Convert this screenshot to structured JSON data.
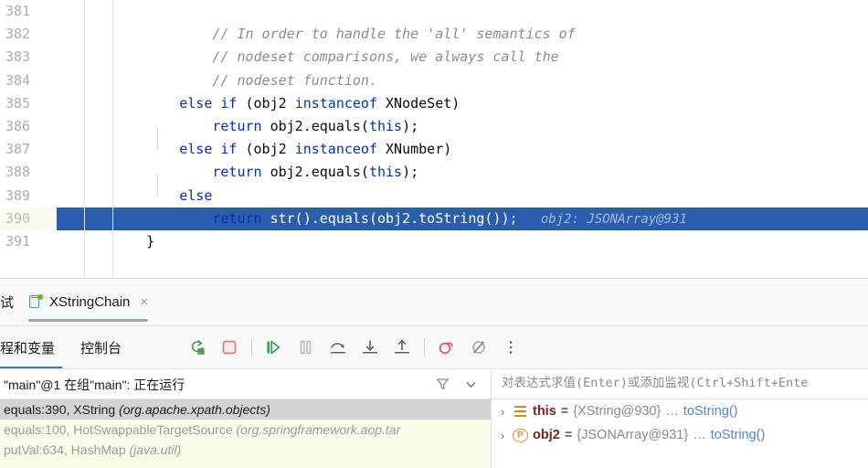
{
  "editor": {
    "lines": [
      {
        "num": "381",
        "segments": []
      },
      {
        "num": "382",
        "segments": [
          {
            "t": "comment",
            "text": "            // In order to handle the 'all' semantics of"
          }
        ]
      },
      {
        "num": "383",
        "segments": [
          {
            "t": "comment",
            "text": "            // nodeset comparisons, we always call the"
          }
        ]
      },
      {
        "num": "384",
        "segments": [
          {
            "t": "comment",
            "text": "            // nodeset function."
          }
        ]
      },
      {
        "num": "385",
        "segments": [
          {
            "t": "plain",
            "text": "        "
          },
          {
            "t": "kw",
            "text": "else"
          },
          {
            "t": "plain",
            "text": " "
          },
          {
            "t": "kw",
            "text": "if"
          },
          {
            "t": "plain",
            "text": " (obj2 "
          },
          {
            "t": "kw",
            "text": "instanceof"
          },
          {
            "t": "plain",
            "text": " XNodeSet)"
          }
        ]
      },
      {
        "num": "386",
        "segments": [
          {
            "t": "plain",
            "text": "            "
          },
          {
            "t": "kw",
            "text": "return"
          },
          {
            "t": "plain",
            "text": " obj2.equals("
          },
          {
            "t": "kw",
            "text": "this"
          },
          {
            "t": "plain",
            "text": ");"
          }
        ]
      },
      {
        "num": "387",
        "segments": [
          {
            "t": "plain",
            "text": "        "
          },
          {
            "t": "kw",
            "text": "else"
          },
          {
            "t": "plain",
            "text": " "
          },
          {
            "t": "kw",
            "text": "if"
          },
          {
            "t": "plain",
            "text": " (obj2 "
          },
          {
            "t": "kw",
            "text": "instanceof"
          },
          {
            "t": "plain",
            "text": " XNumber)"
          }
        ]
      },
      {
        "num": "388",
        "segments": [
          {
            "t": "plain",
            "text": "            "
          },
          {
            "t": "kw",
            "text": "return"
          },
          {
            "t": "plain",
            "text": " obj2.equals("
          },
          {
            "t": "kw",
            "text": "this"
          },
          {
            "t": "plain",
            "text": ");"
          }
        ]
      },
      {
        "num": "389",
        "segments": [
          {
            "t": "plain",
            "text": "        "
          },
          {
            "t": "kw",
            "text": "else"
          }
        ]
      },
      {
        "num": "390",
        "selected": true,
        "current": true,
        "segments": [
          {
            "t": "plain",
            "text": "            "
          },
          {
            "t": "kw",
            "text": "return"
          },
          {
            "t": "plain",
            "text": " str().equals(obj2.toString());"
          },
          {
            "t": "hint",
            "text": "   obj2: JSONArray@931"
          }
        ]
      },
      {
        "num": "391",
        "segments": [
          {
            "t": "plain",
            "text": "    }"
          }
        ]
      }
    ],
    "colors": {
      "keyword": "#0033b3",
      "comment": "#8c8c8c",
      "selection": "#2a5db0",
      "current_line": "#fcfaef"
    }
  },
  "tabbar": {
    "debug_tab_label": "试",
    "file_tab_label": "XStringChain",
    "close_label": "×"
  },
  "debugbar": {
    "tabs": [
      {
        "label": "程和变量",
        "active": true
      },
      {
        "label": "控制台",
        "active": false
      }
    ],
    "actions": [
      {
        "name": "rerun-icon"
      },
      {
        "name": "stop-icon"
      },
      {
        "name": "resume-icon"
      },
      {
        "name": "pause-icon"
      },
      {
        "name": "step-over-icon"
      },
      {
        "name": "step-into-icon"
      },
      {
        "name": "step-out-icon"
      },
      {
        "name": "view-breakpoints-icon"
      },
      {
        "name": "mute-breakpoints-icon"
      },
      {
        "name": "more-options-icon"
      }
    ]
  },
  "threads": {
    "selected": "\"main\"@1 在组\"main\": 正在运行",
    "frames": [
      {
        "method": "equals:390, XString ",
        "pkg": "(org.apache.xpath.objects)",
        "selected": true
      },
      {
        "method": "equals:100, HotSwappableTargetSource ",
        "pkg": "(org.springframework.aop.tar",
        "selected": false
      },
      {
        "method": "putVal:634, HashMap ",
        "pkg": "(java.util)",
        "selected": false
      }
    ]
  },
  "watch": {
    "placeholder": "对表达式求值(Enter)或添加监视(Ctrl+Shift+Ente",
    "value": ""
  },
  "variables": [
    {
      "arrow": "›",
      "icon": "field-icon",
      "name": "this",
      "eq": "=",
      "value": "{XString@930}",
      "dots": "…",
      "tostring": "toString()"
    },
    {
      "arrow": "›",
      "icon": "parameter-icon",
      "name": "obj2",
      "eq": "=",
      "value": "{JSONArray@931}",
      "dots": "…",
      "tostring": "toString()"
    }
  ]
}
